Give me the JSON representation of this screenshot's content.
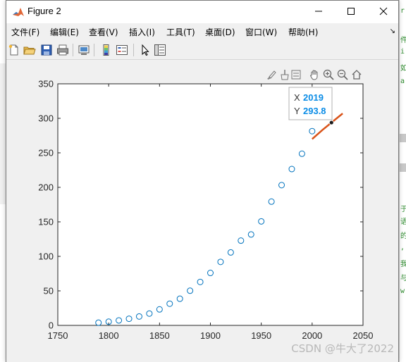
{
  "window": {
    "title": "Figure 2",
    "menu": [
      "文件(F)",
      "编辑(E)",
      "查看(V)",
      "插入(I)",
      "工具(T)",
      "桌面(D)",
      "窗口(W)",
      "帮助(H)"
    ],
    "toolbar_icons": [
      "new-figure-icon",
      "open-icon",
      "save-icon",
      "print-icon",
      "link-plot-icon",
      "insert-colorbar-icon",
      "insert-legend-icon",
      "select-pointer-icon",
      "property-inspector-icon"
    ],
    "axes_toolbar_icons": [
      "brush-icon",
      "datatip-icon",
      "restore-view-icon",
      "pan-icon",
      "zoom-in-icon",
      "zoom-out-icon",
      "home-icon"
    ]
  },
  "chart_data": {
    "type": "scatter",
    "x_ticks": [
      "1750",
      "1800",
      "1850",
      "1900",
      "1950",
      "2000",
      "2050"
    ],
    "y_ticks": [
      "0",
      "50",
      "100",
      "150",
      "200",
      "250",
      "300",
      "350"
    ],
    "xlim": [
      1750,
      2050
    ],
    "ylim": [
      0,
      350
    ],
    "series": [
      {
        "marker": "circle-open",
        "color": "#0072bd",
        "x": [
          1790,
          1800,
          1810,
          1820,
          1830,
          1840,
          1850,
          1860,
          1870,
          1880,
          1890,
          1900,
          1910,
          1920,
          1930,
          1940,
          1950,
          1960,
          1970,
          1980,
          1990,
          2000
        ],
        "y": [
          3.9,
          5.3,
          7.2,
          9.6,
          12.9,
          17.1,
          23.2,
          31.4,
          38.6,
          50.2,
          62.9,
          76.0,
          92.0,
          105.7,
          122.8,
          131.7,
          150.7,
          179.3,
          203.2,
          226.5,
          248.7,
          281.4
        ]
      },
      {
        "marker": "line",
        "color": "#d95319",
        "x": [
          2000,
          2010,
          2020,
          2030
        ],
        "y": [
          270,
          283,
          295,
          307
        ]
      }
    ],
    "datatip": {
      "x_label": "X",
      "x_value": "2019",
      "y_label": "Y",
      "y_value": "293.8",
      "x": 2019,
      "y": 293.8
    }
  },
  "watermark": "CSDN @牛大了2022"
}
